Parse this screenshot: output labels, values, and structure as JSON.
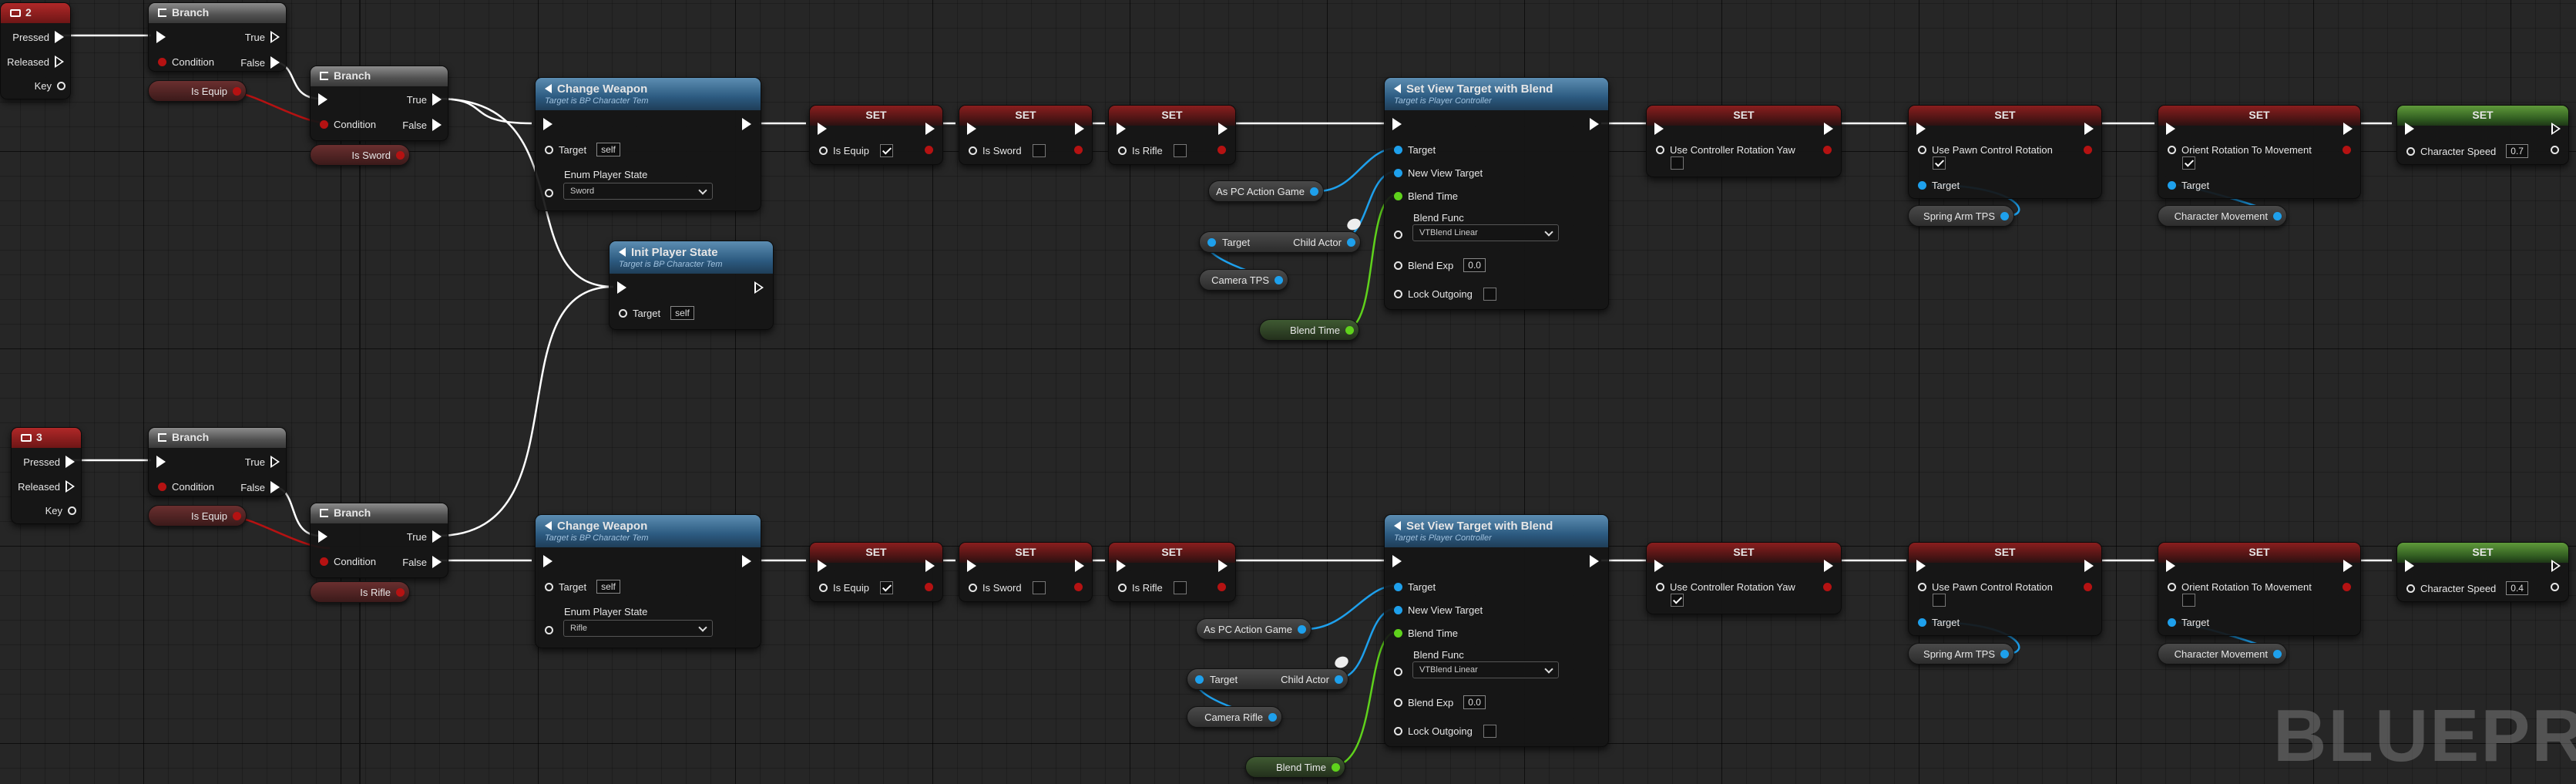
{
  "watermark": "BLUEPRIN",
  "key2": {
    "title": "2",
    "pressed": "Pressed",
    "released": "Released",
    "key": "Key"
  },
  "key3": {
    "title": "3",
    "pressed": "Pressed",
    "released": "Released",
    "key": "Key"
  },
  "branch_titles": [
    "Branch",
    "Branch",
    "Branch",
    "Branch"
  ],
  "branch_pins": {
    "true": "True",
    "false": "False",
    "condition": "Condition"
  },
  "vars": {
    "is_equip": "Is Equip",
    "is_sword": "Is Sword",
    "is_rifle": "Is Rifle"
  },
  "change_weapon": {
    "title": "Change Weapon",
    "subtitle": "Target is BP Character Tem",
    "target": "Target",
    "target_value": "self",
    "enum_label": "Enum Player State",
    "row1_value": "Sword",
    "row2_value": "Rifle"
  },
  "init_player_state": {
    "title": "Init Player State",
    "subtitle": "Target is BP Character Tem",
    "target": "Target",
    "target_value": "self"
  },
  "set_label": "SET",
  "set_vars": {
    "is_equip": "Is Equip",
    "is_sword": "Is Sword",
    "is_rifle": "Is Rifle"
  },
  "svtb": {
    "title": "Set View Target with Blend",
    "subtitle": "Target is Player Controller",
    "target": "Target",
    "new_view_target": "New View Target",
    "blend_time": "Blend Time",
    "blend_func": "Blend Func",
    "blend_func_value": "VTBlend Linear",
    "blend_exp": "Blend Exp",
    "blend_exp_value": "0.0",
    "lock_outgoing": "Lock Outgoing"
  },
  "getters": {
    "as_pc_action_game": "As PC Action Game",
    "target": "Target",
    "child_actor": "Child Actor",
    "camera_tps": "Camera TPS",
    "camera_rifle": "Camera Rifle",
    "blend_time": "Blend Time",
    "spring_arm_tps": "Spring Arm TPS",
    "character_movement": "Character Movement"
  },
  "rot_sets": {
    "use_controller_rotation_yaw": "Use Controller Rotation Yaw",
    "use_pawn_control_rotation": "Use Pawn Control Rotation",
    "orient_rotation_to_movement": "Orient Rotation To Movement",
    "target": "Target"
  },
  "speed": {
    "label": "Character Speed",
    "row1_value": "0.7",
    "row2_value": "0.4"
  }
}
